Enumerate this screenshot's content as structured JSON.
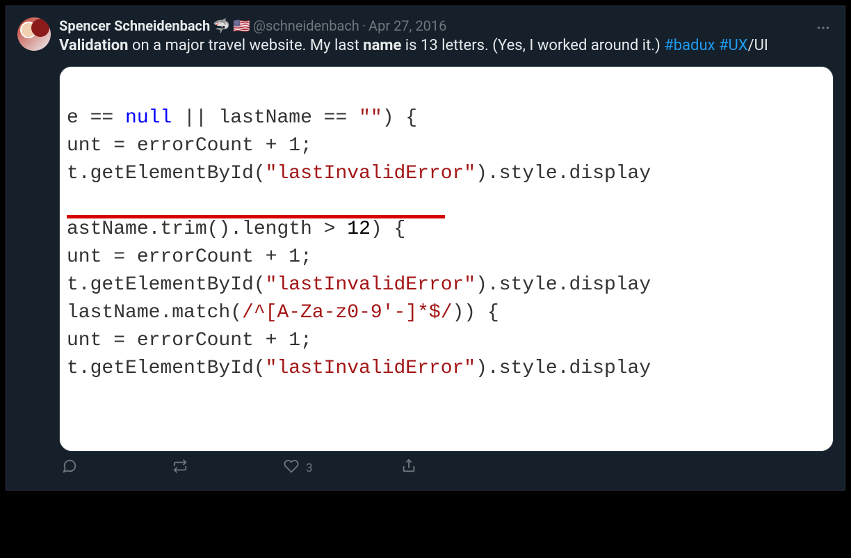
{
  "author": {
    "display_name": "Spencer Schneidenbach",
    "handle": "@schneidenbach",
    "date": "Apr 27, 2016",
    "separator": "·",
    "emoji_shark": "🦈",
    "emoji_flag": "🇺🇸"
  },
  "tweet": {
    "seg1_bold": "Validation",
    "seg2": " on a major travel website. My last ",
    "seg3_bold": "name",
    "seg4": " is 13 letters. (Yes, I worked around it.) ",
    "hashtag1": "#badux",
    "space": " ",
    "hashtag2": "#UX",
    "trailing": "/UI"
  },
  "code": {
    "l1a": "e == ",
    "l1b": "null",
    "l1c": " || lastName == ",
    "l1d": "\"\"",
    "l1e": ") {",
    "l2": "unt = errorCount + 1;",
    "l3a": "t.getElementById(",
    "l3b": "\"lastInvalidError\"",
    "l3c": ").style.display",
    "blank": " ",
    "l5a": "astName.trim().length > ",
    "l5b": "12",
    "l5c": ") {",
    "l6": "unt = errorCount + 1;",
    "l7a": "t.getElementById(",
    "l7b": "\"lastInvalidError\"",
    "l7c": ").style.display",
    "l8a": "lastName.match(",
    "l8b": "/^[A-Za-z0-9'-]*$/",
    "l8c": ")) {",
    "l9": "unt = errorCount + 1;",
    "l10a": "t.getElementById(",
    "l10b": "\"lastInvalidError\"",
    "l10c": ").style.display"
  },
  "actions": {
    "reply_count": "",
    "retweet_count": "",
    "like_count": "3",
    "share_count": ""
  }
}
